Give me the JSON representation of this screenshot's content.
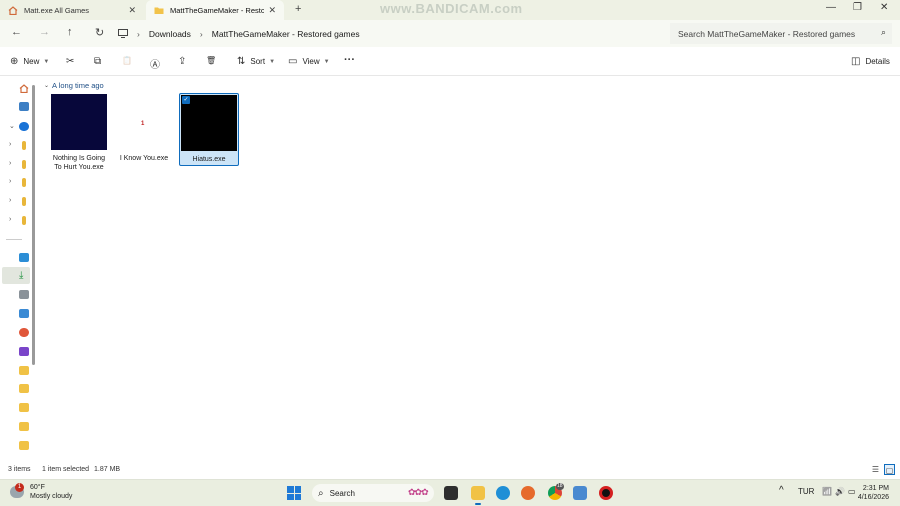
{
  "watermark": "www.BANDICAM.com",
  "tabs": [
    {
      "title": "Matt.exe All Games",
      "close": "✕"
    },
    {
      "title": "MattTheGameMaker - Restore",
      "close": "✕"
    }
  ],
  "new_tab": "+",
  "window_controls": {
    "minimize": "—",
    "maximize": "❐",
    "close": "✕"
  },
  "nav": {
    "back": "←",
    "forward": "→",
    "up": "↑",
    "refresh": "↻"
  },
  "breadcrumb": {
    "root_icon": "monitor-icon",
    "items": [
      "Downloads",
      "MattTheGameMaker - Restored games"
    ],
    "separator": "›"
  },
  "search": {
    "placeholder": "Search MattTheGameMaker - Restored games",
    "icon": "⌕"
  },
  "command_bar": {
    "new_label": "New",
    "sort_label": "Sort",
    "view_label": "View",
    "more": "···",
    "details_label": "Details",
    "icons": {
      "cut": "✂",
      "copy": "⧉",
      "paste": "📋",
      "rename": "Ⓐ",
      "share": "⇪",
      "delete": "🗑"
    }
  },
  "group": {
    "label": "A long time ago",
    "chevron": "⌄"
  },
  "files": [
    {
      "name": "Nothing Is Going To Hurt You.exe",
      "selected": false,
      "thumb_color": "#07073a"
    },
    {
      "name": "I Know You.exe",
      "selected": false,
      "small_icon": "1"
    },
    {
      "name": "Hiatus.exe",
      "selected": true,
      "thumb_color": "#000000",
      "check": "✓"
    }
  ],
  "status": {
    "item_count": "3 items",
    "selection": "1 item selected",
    "size": "1.87 MB"
  },
  "taskbar": {
    "weather_temp": "60°F",
    "weather_desc": "Mostly cloudy",
    "weather_badge": "1",
    "search_label": "Search",
    "search_icon": "⌕",
    "tray_chevron": "^",
    "language": "TUR",
    "wifi": "📶",
    "volume": "🔊",
    "battery": "▭",
    "time": "2:31 PM",
    "date": "4/16/2026",
    "chrome_badge": "18"
  },
  "colors": {
    "accent": "#0f6cbd",
    "selection_bg": "#cce4f7",
    "group_header": "#1f4f86",
    "chrome_bg": "#eef1e4"
  }
}
